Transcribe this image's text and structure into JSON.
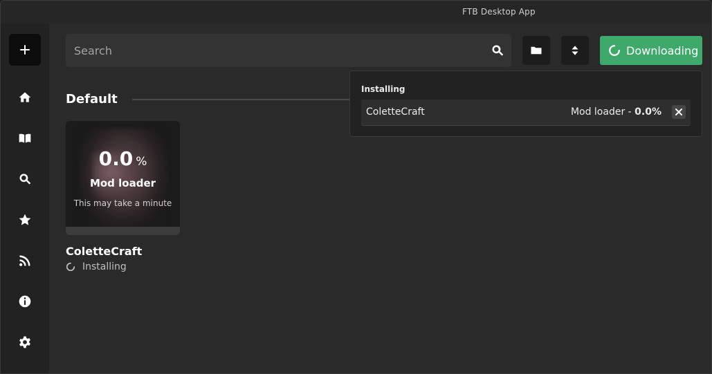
{
  "window": {
    "title": "FTB Desktop App"
  },
  "sidebar": {
    "add_icon": "plus-icon",
    "items": [
      {
        "name": "home",
        "icon": "home-icon"
      },
      {
        "name": "library",
        "icon": "book-icon"
      },
      {
        "name": "browse",
        "icon": "search-icon"
      },
      {
        "name": "featured",
        "icon": "star-icon"
      },
      {
        "name": "news",
        "icon": "rss-icon"
      },
      {
        "name": "about",
        "icon": "info-icon"
      },
      {
        "name": "settings",
        "icon": "gear-icon"
      }
    ]
  },
  "toolbar": {
    "search_placeholder": "Search",
    "search_value": "",
    "folder_icon": "folder-icon",
    "sort_icon": "sort-icon",
    "download_label": "Downloading",
    "download_color": "#3ea96a"
  },
  "section": {
    "title": "Default"
  },
  "instance": {
    "name": "ColetteCraft",
    "progress_number": "0.0",
    "progress_sign": "%",
    "progress_fraction": 0.0,
    "stage": "Mod loader",
    "hint": "This may take a minute",
    "status": "Installing"
  },
  "popup": {
    "title": "Installing",
    "row": {
      "name": "ColetteCraft",
      "stage": "Mod loader - ",
      "percent": "0.0%"
    }
  }
}
